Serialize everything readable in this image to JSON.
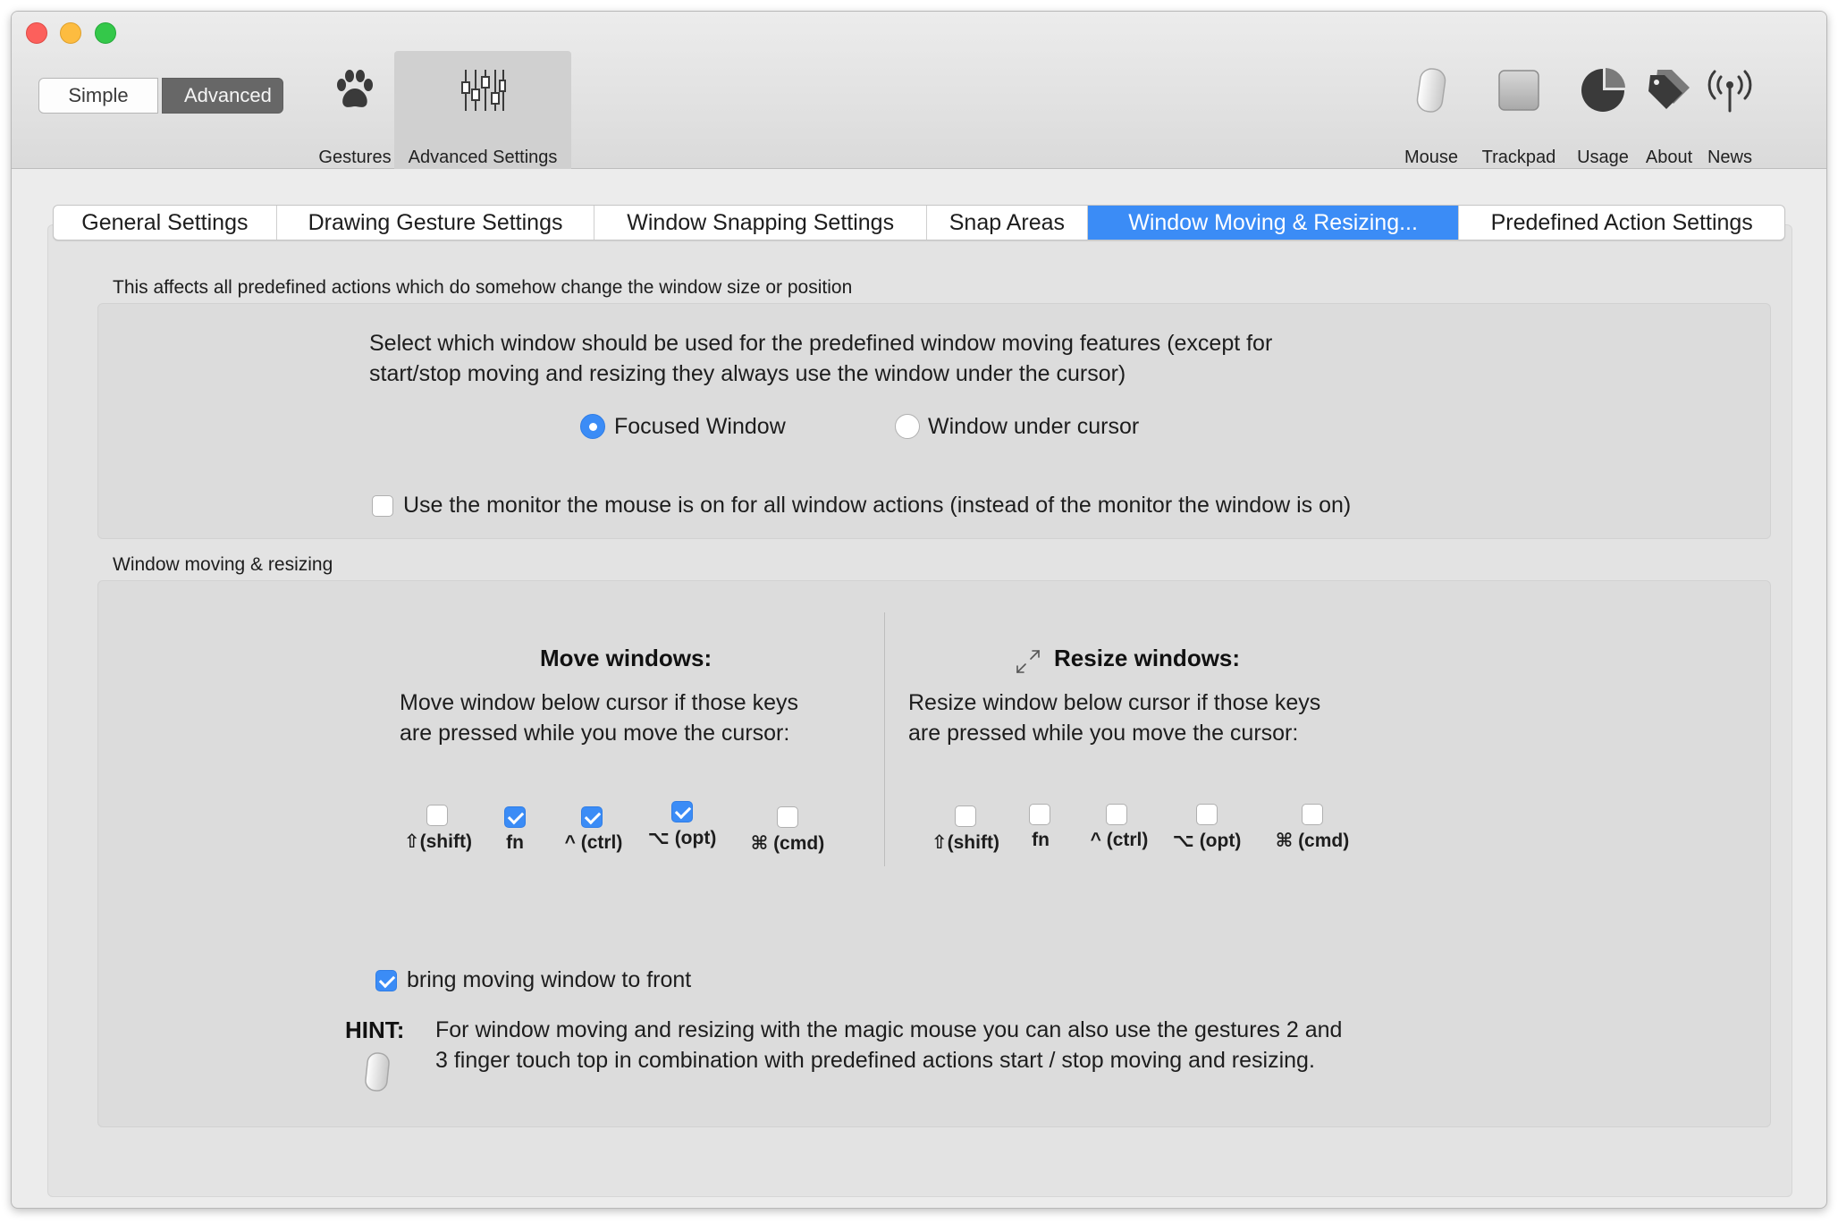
{
  "toolbar": {
    "mode_simple": "Simple",
    "mode_advanced": "Advanced",
    "gestures_label": "Gestures",
    "advanced_settings_label": "Advanced Settings",
    "mouse_label": "Mouse",
    "trackpad_label": "Trackpad",
    "usage_label": "Usage",
    "about_label": "About",
    "news_label": "News"
  },
  "tabs": [
    {
      "label": "General Settings"
    },
    {
      "label": "Drawing Gesture Settings"
    },
    {
      "label": "Window Snapping Settings"
    },
    {
      "label": "Snap Areas"
    },
    {
      "label": "Window Moving & Resizing..."
    },
    {
      "label": "Predefined Action Settings"
    }
  ],
  "section1": {
    "title": "This affects all predefined actions which do somehow change the window size or position",
    "description_line1": "Select which window should be used for the predefined window moving features (except for",
    "description_line2": "start/stop moving and resizing they always use the window under the cursor)",
    "radio_focused": "Focused Window",
    "radio_under_cursor": "Window under cursor",
    "monitor_checkbox": "Use the monitor the mouse is on for all window actions (instead of the monitor the window is on)"
  },
  "section2": {
    "title": "Window moving & resizing",
    "move": {
      "heading": "Move windows:",
      "line1": "Move window below cursor if those keys",
      "line2": "are pressed while you move the cursor:",
      "keys": [
        {
          "label": "⇧(shift)",
          "checked": false
        },
        {
          "label": "fn",
          "checked": true
        },
        {
          "label": "^ (ctrl)",
          "checked": true
        },
        {
          "label": "⌥ (opt)",
          "checked": true
        },
        {
          "label": "⌘ (cmd)",
          "checked": false
        }
      ]
    },
    "resize": {
      "heading": "Resize windows:",
      "line1": "Resize window below cursor if those keys",
      "line2": "are pressed while you move the cursor:",
      "keys": [
        {
          "label": "⇧(shift)",
          "checked": false
        },
        {
          "label": "fn",
          "checked": false
        },
        {
          "label": "^ (ctrl)",
          "checked": false
        },
        {
          "label": "⌥ (opt)",
          "checked": false
        },
        {
          "label": "⌘ (cmd)",
          "checked": false
        }
      ]
    },
    "bring_front": "bring moving window to front",
    "hint_label": "HINT:",
    "hint_line1": "For window moving and resizing with the magic mouse you can also use the gestures 2 and",
    "hint_line2": "3 finger touch top in combination with predefined actions start / stop moving and resizing."
  },
  "colors": {
    "accent": "#3b8cf6",
    "window_bg": "#ececec",
    "group_bg": "#dcdcdc"
  }
}
